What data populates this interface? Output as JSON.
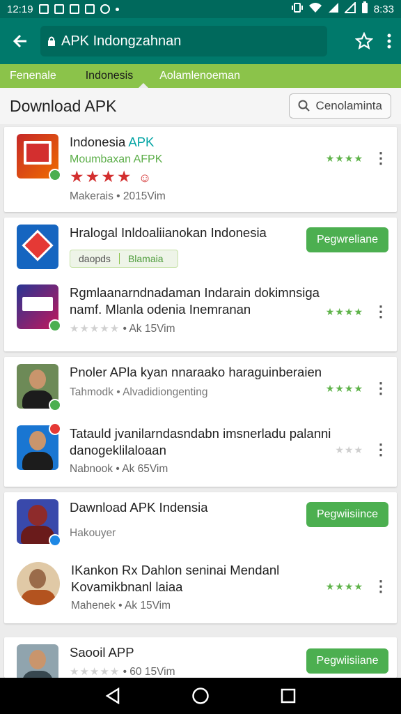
{
  "status_bar": {
    "time": "12:19",
    "right_time": "8:33"
  },
  "app_bar": {
    "url": "APK Indongzahnan"
  },
  "tabs": [
    {
      "label": "Fenenale"
    },
    {
      "label": "Indonesis"
    },
    {
      "label": "Aolamlenoeman"
    }
  ],
  "section": {
    "title": "Download APK",
    "search_label": "Cenolaminta"
  },
  "items": [
    {
      "title_main": "Indonesia ",
      "title_accent": "APK",
      "subtitle": "Moumbaxan AFPK",
      "meta": "Makerais • 2015Vim",
      "rating": 4
    },
    {
      "title": "Hralogal Inldoaliianokan Indonesia",
      "chip1": "daopds",
      "chip2": "Blamaia",
      "action": "Pegwreliane"
    },
    {
      "title": "Rgmlaanarndnadaman Indarain dokimnsiga namf. Mlanla odenia Inemranan",
      "meta": "Ak 15Vim",
      "rating": 3
    },
    {
      "title": "Pnoler APla kyan nnaraako haraguinberaien",
      "meta": "Tahmodk • Alvadidiongenting",
      "rating": 3
    },
    {
      "title": "Tatauld jvanilarndasndabn imsnerladu palanni danogeklilaloaan",
      "meta": "Nabnook • Ak 65Vim",
      "rating": 3
    },
    {
      "title": "Dawnload APK Indensia",
      "meta": "Hakouyer",
      "action": "Pegwiisiince"
    },
    {
      "title": "IKankon Rx Dahlon seninai Mendanl Kovamikbnanl laiaa",
      "meta": "Mahenek • Ak 15Vim",
      "rating": 3
    },
    {
      "title": "Saooil APP",
      "meta": "• 60 15Vim",
      "action": "Pegwiisiiane"
    }
  ],
  "colors": {
    "teal_dark": "#00695c",
    "teal": "#00796b",
    "green_tab": "#8bc34a",
    "install": "#4caf50"
  }
}
